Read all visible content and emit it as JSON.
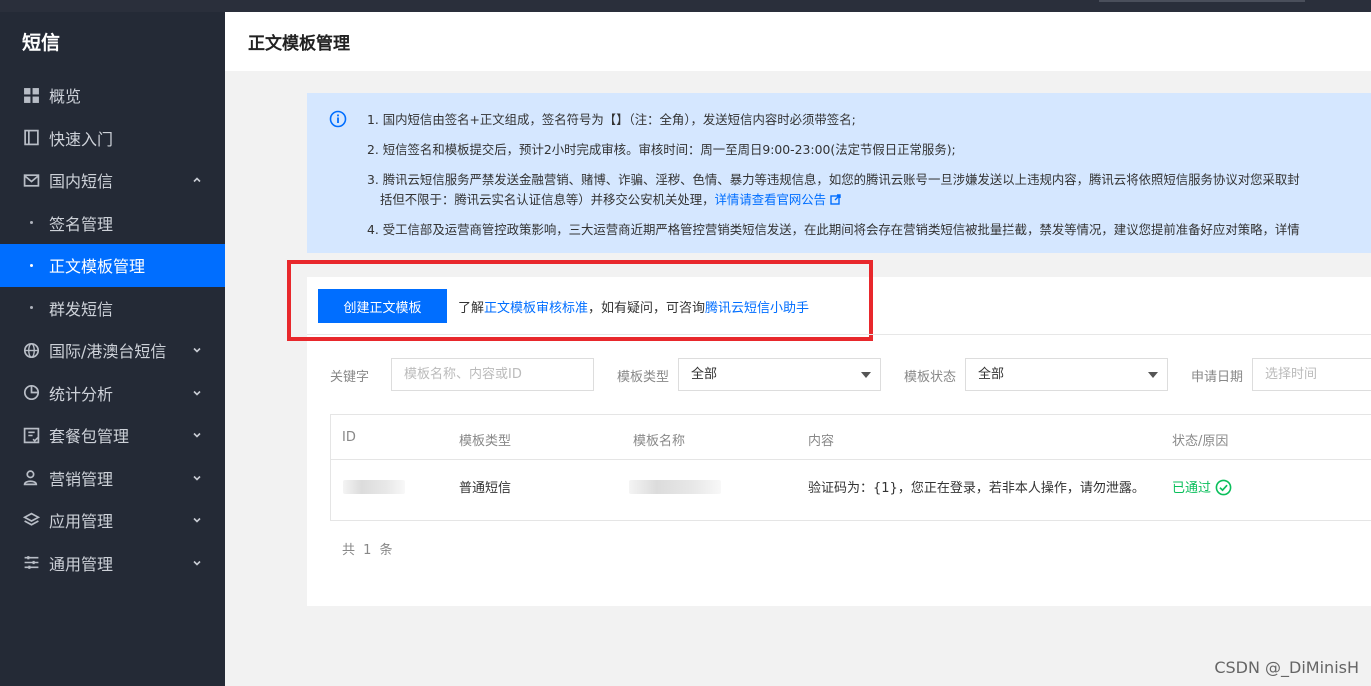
{
  "sidebar": {
    "title": "短信",
    "items": [
      {
        "label": "概览"
      },
      {
        "label": "快速入门"
      },
      {
        "label": "国内短信"
      },
      {
        "label": "签名管理"
      },
      {
        "label": "正文模板管理"
      },
      {
        "label": "群发短信"
      },
      {
        "label": "国际/港澳台短信"
      },
      {
        "label": "统计分析"
      },
      {
        "label": "套餐包管理"
      },
      {
        "label": "营销管理"
      },
      {
        "label": "应用管理"
      },
      {
        "label": "通用管理"
      }
    ]
  },
  "page": {
    "title": "正文模板管理"
  },
  "notice": {
    "line1": "1. 国内短信由签名+正文组成，签名符号为【】（注：全角），发送短信内容时必须带签名;",
    "line2": "2. 短信签名和模板提交后，预计2小时完成审核。审核时间：周一至周日9:00-23:00(法定节假日正常服务);",
    "line3a": "3. 腾讯云短信服务严禁发送金融营销、赌博、诈骗、淫秽、色情、暴力等违规信息，如您的腾讯云账号一旦涉嫌发送以上违规内容，腾讯云将依照短信服务协议对您采取封",
    "line3b": "括但不限于：腾讯云实名认证信息等）并移交公安机关处理，",
    "line3_link": "详情请查看官网公告",
    "line4": "4. 受工信部及运营商管控政策影响，三大运营商近期严格管控营销类短信发送，在此期间将会存在营销类短信被批量拦截，禁发等情况，建议您提前准备好应对策略，详情"
  },
  "toolbar": {
    "create_label": "创建正文模板",
    "help_prefix": "了解",
    "help_link1": "正文模板审核标准",
    "help_mid": "，如有疑问，可咨询",
    "help_link2": "腾讯云短信小助手"
  },
  "filters": {
    "keyword_label": "关键字",
    "keyword_placeholder": "模板名称、内容或ID",
    "type_label": "模板类型",
    "type_value": "全部",
    "status_label": "模板状态",
    "status_value": "全部",
    "date_label": "申请日期",
    "date_placeholder": "选择时间"
  },
  "table": {
    "headers": [
      "ID",
      "模板类型",
      "模板名称",
      "内容",
      "状态/原因"
    ],
    "rows": [
      {
        "type": "普通短信",
        "content": "验证码为：{1}，您正在登录，若非本人操作，请勿泄露。",
        "status": "已通过"
      }
    ],
    "total": "共 1 条"
  },
  "watermark": "CSDN @_DiMinisH",
  "colors": {
    "accent": "#006eff",
    "sidebar_bg": "#242a36",
    "notice_bg": "#d5e7ff",
    "highlight": "#e8282c",
    "success": "#0abf5b"
  }
}
